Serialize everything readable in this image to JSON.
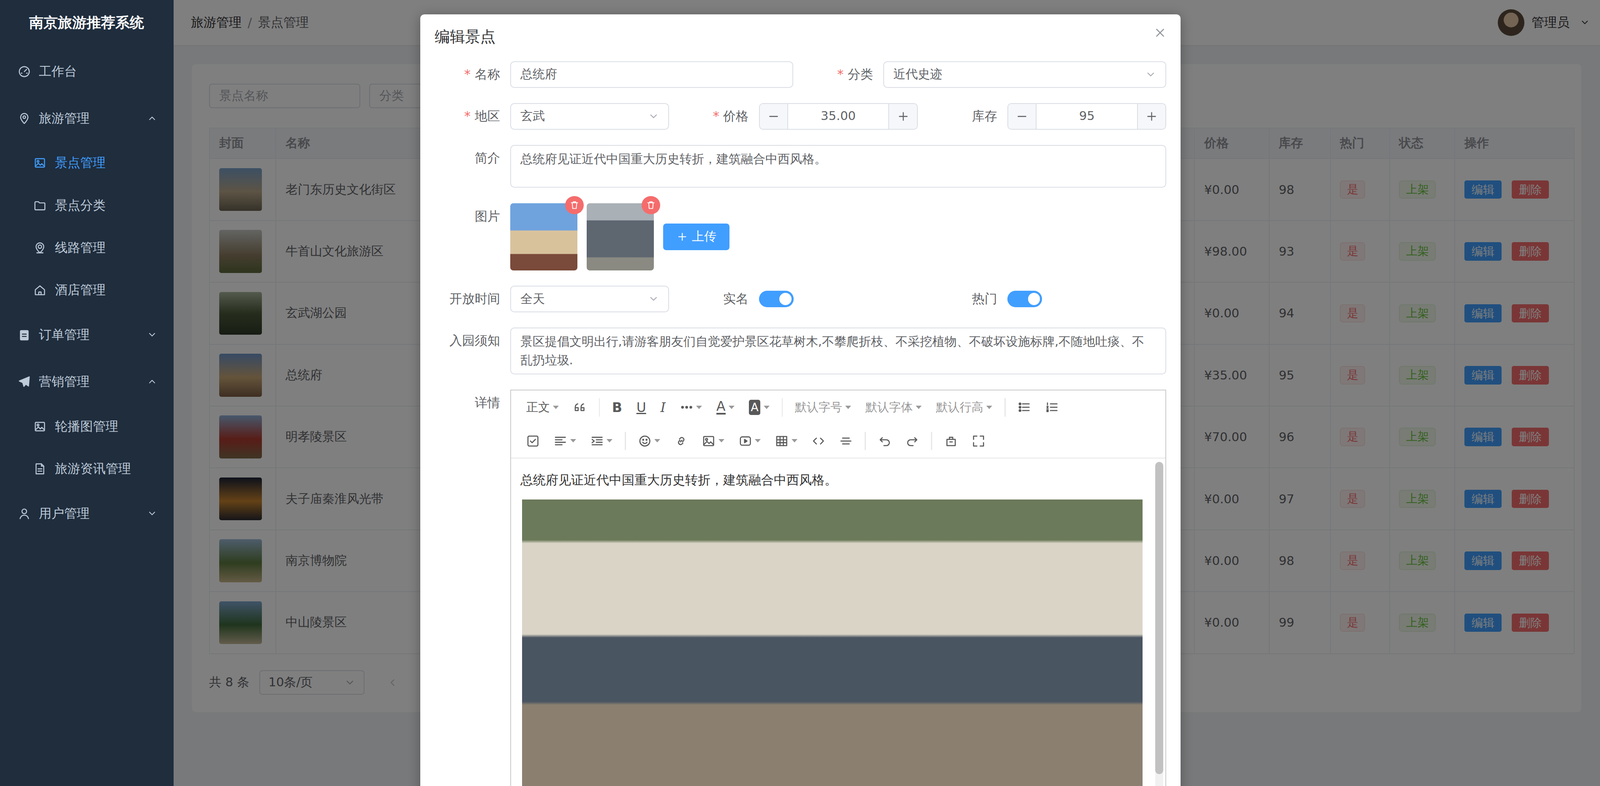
{
  "app": {
    "title": "南京旅游推荐系统"
  },
  "sidebar": {
    "items": [
      {
        "label": "工作台",
        "submenu": false,
        "expanded": false,
        "children": []
      },
      {
        "label": "旅游管理",
        "submenu": true,
        "expanded": true,
        "children": [
          {
            "label": "景点管理",
            "selected": true
          },
          {
            "label": "景点分类",
            "selected": false
          },
          {
            "label": "线路管理",
            "selected": false
          },
          {
            "label": "酒店管理",
            "selected": false
          }
        ]
      },
      {
        "label": "订单管理",
        "submenu": true,
        "expanded": false,
        "children": []
      },
      {
        "label": "营销管理",
        "submenu": true,
        "expanded": true,
        "children": [
          {
            "label": "轮播图管理",
            "selected": false
          },
          {
            "label": "旅游资讯管理",
            "selected": false
          }
        ]
      },
      {
        "label": "用户管理",
        "submenu": true,
        "expanded": false,
        "children": []
      }
    ]
  },
  "header": {
    "breadcrumb": [
      {
        "label": "旅游管理"
      },
      {
        "label": "景点管理"
      }
    ],
    "separator": "/",
    "user": {
      "name": "管理员"
    }
  },
  "filters": {
    "name_placeholder": "景点名称",
    "category_placeholder": "分类"
  },
  "table": {
    "columns": [
      "封面",
      "名称",
      "价格",
      "库存",
      "热门",
      "状态",
      "操作"
    ],
    "rows": [
      {
        "name": "老门东历史文化街区",
        "price": "¥0.00",
        "stock": "98",
        "hot": "是",
        "status": "上架",
        "actions": [
          "编辑",
          "删除"
        ]
      },
      {
        "name": "牛首山文化旅游区",
        "price": "¥98.00",
        "stock": "93",
        "hot": "是",
        "status": "上架",
        "actions": [
          "编辑",
          "删除"
        ]
      },
      {
        "name": "玄武湖公园",
        "price": "¥0.00",
        "stock": "94",
        "hot": "是",
        "status": "上架",
        "actions": [
          "编辑",
          "删除"
        ]
      },
      {
        "name": "总统府",
        "price": "¥35.00",
        "stock": "95",
        "hot": "是",
        "status": "上架",
        "actions": [
          "编辑",
          "删除"
        ]
      },
      {
        "name": "明孝陵景区",
        "price": "¥70.00",
        "stock": "96",
        "hot": "是",
        "status": "上架",
        "actions": [
          "编辑",
          "删除"
        ]
      },
      {
        "name": "夫子庙秦淮风光带",
        "price": "¥0.00",
        "stock": "97",
        "hot": "是",
        "status": "上架",
        "actions": [
          "编辑",
          "删除"
        ]
      },
      {
        "name": "南京博物院",
        "price": "¥0.00",
        "stock": "98",
        "hot": "是",
        "status": "上架",
        "actions": [
          "编辑",
          "删除"
        ]
      },
      {
        "name": "中山陵景区",
        "price": "¥0.00",
        "stock": "99",
        "hot": "是",
        "status": "上架",
        "actions": [
          "编辑",
          "删除"
        ]
      }
    ]
  },
  "pagination": {
    "total": "共 8 条",
    "page_size": "10条/页"
  },
  "dialog": {
    "title": "编辑景点",
    "required_mark": "*",
    "fields": {
      "name": {
        "label": "名称",
        "required": true,
        "value": "总统府"
      },
      "category": {
        "label": "分类",
        "required": true,
        "value": "近代史迹"
      },
      "region": {
        "label": "地区",
        "required": true,
        "value": "玄武"
      },
      "price": {
        "label": "价格",
        "required": true,
        "value": "35.00"
      },
      "stock": {
        "label": "库存",
        "required": false,
        "value": "95"
      },
      "intro": {
        "label": "简介",
        "value": "总统府见证近代中国重大历史转折，建筑融合中西风格。"
      },
      "images": {
        "label": "图片",
        "photos": [
          {
            "deletable": true
          },
          {
            "deletable": true
          }
        ],
        "upload": "上传"
      },
      "open_time": {
        "label": "开放时间",
        "value": "全天"
      },
      "real_name": {
        "label": "实名",
        "on": true
      },
      "hot": {
        "label": "热门",
        "on": true
      },
      "notice": {
        "label": "入园须知",
        "value": "景区提倡文明出行,请游客朋友们自觉爱护景区花草树木,不攀爬折枝、不采挖植物、不破坏设施标牌,不随地吐痰、不乱扔垃圾."
      },
      "detail": {
        "label": "详情",
        "toolbar": {
          "block_format": "正文",
          "bold": "B",
          "underline": "U",
          "italic": "I",
          "font_color": "A",
          "bg_color": "A",
          "font_size": "默认字号",
          "font_family": "默认字体",
          "line_height": "默认行高"
        },
        "text": "总统府见证近代中国重大历史转折，建筑融合中西风格。",
        "has_image": true,
        "scrollbar": {
          "level": 0.83
        }
      }
    }
  }
}
